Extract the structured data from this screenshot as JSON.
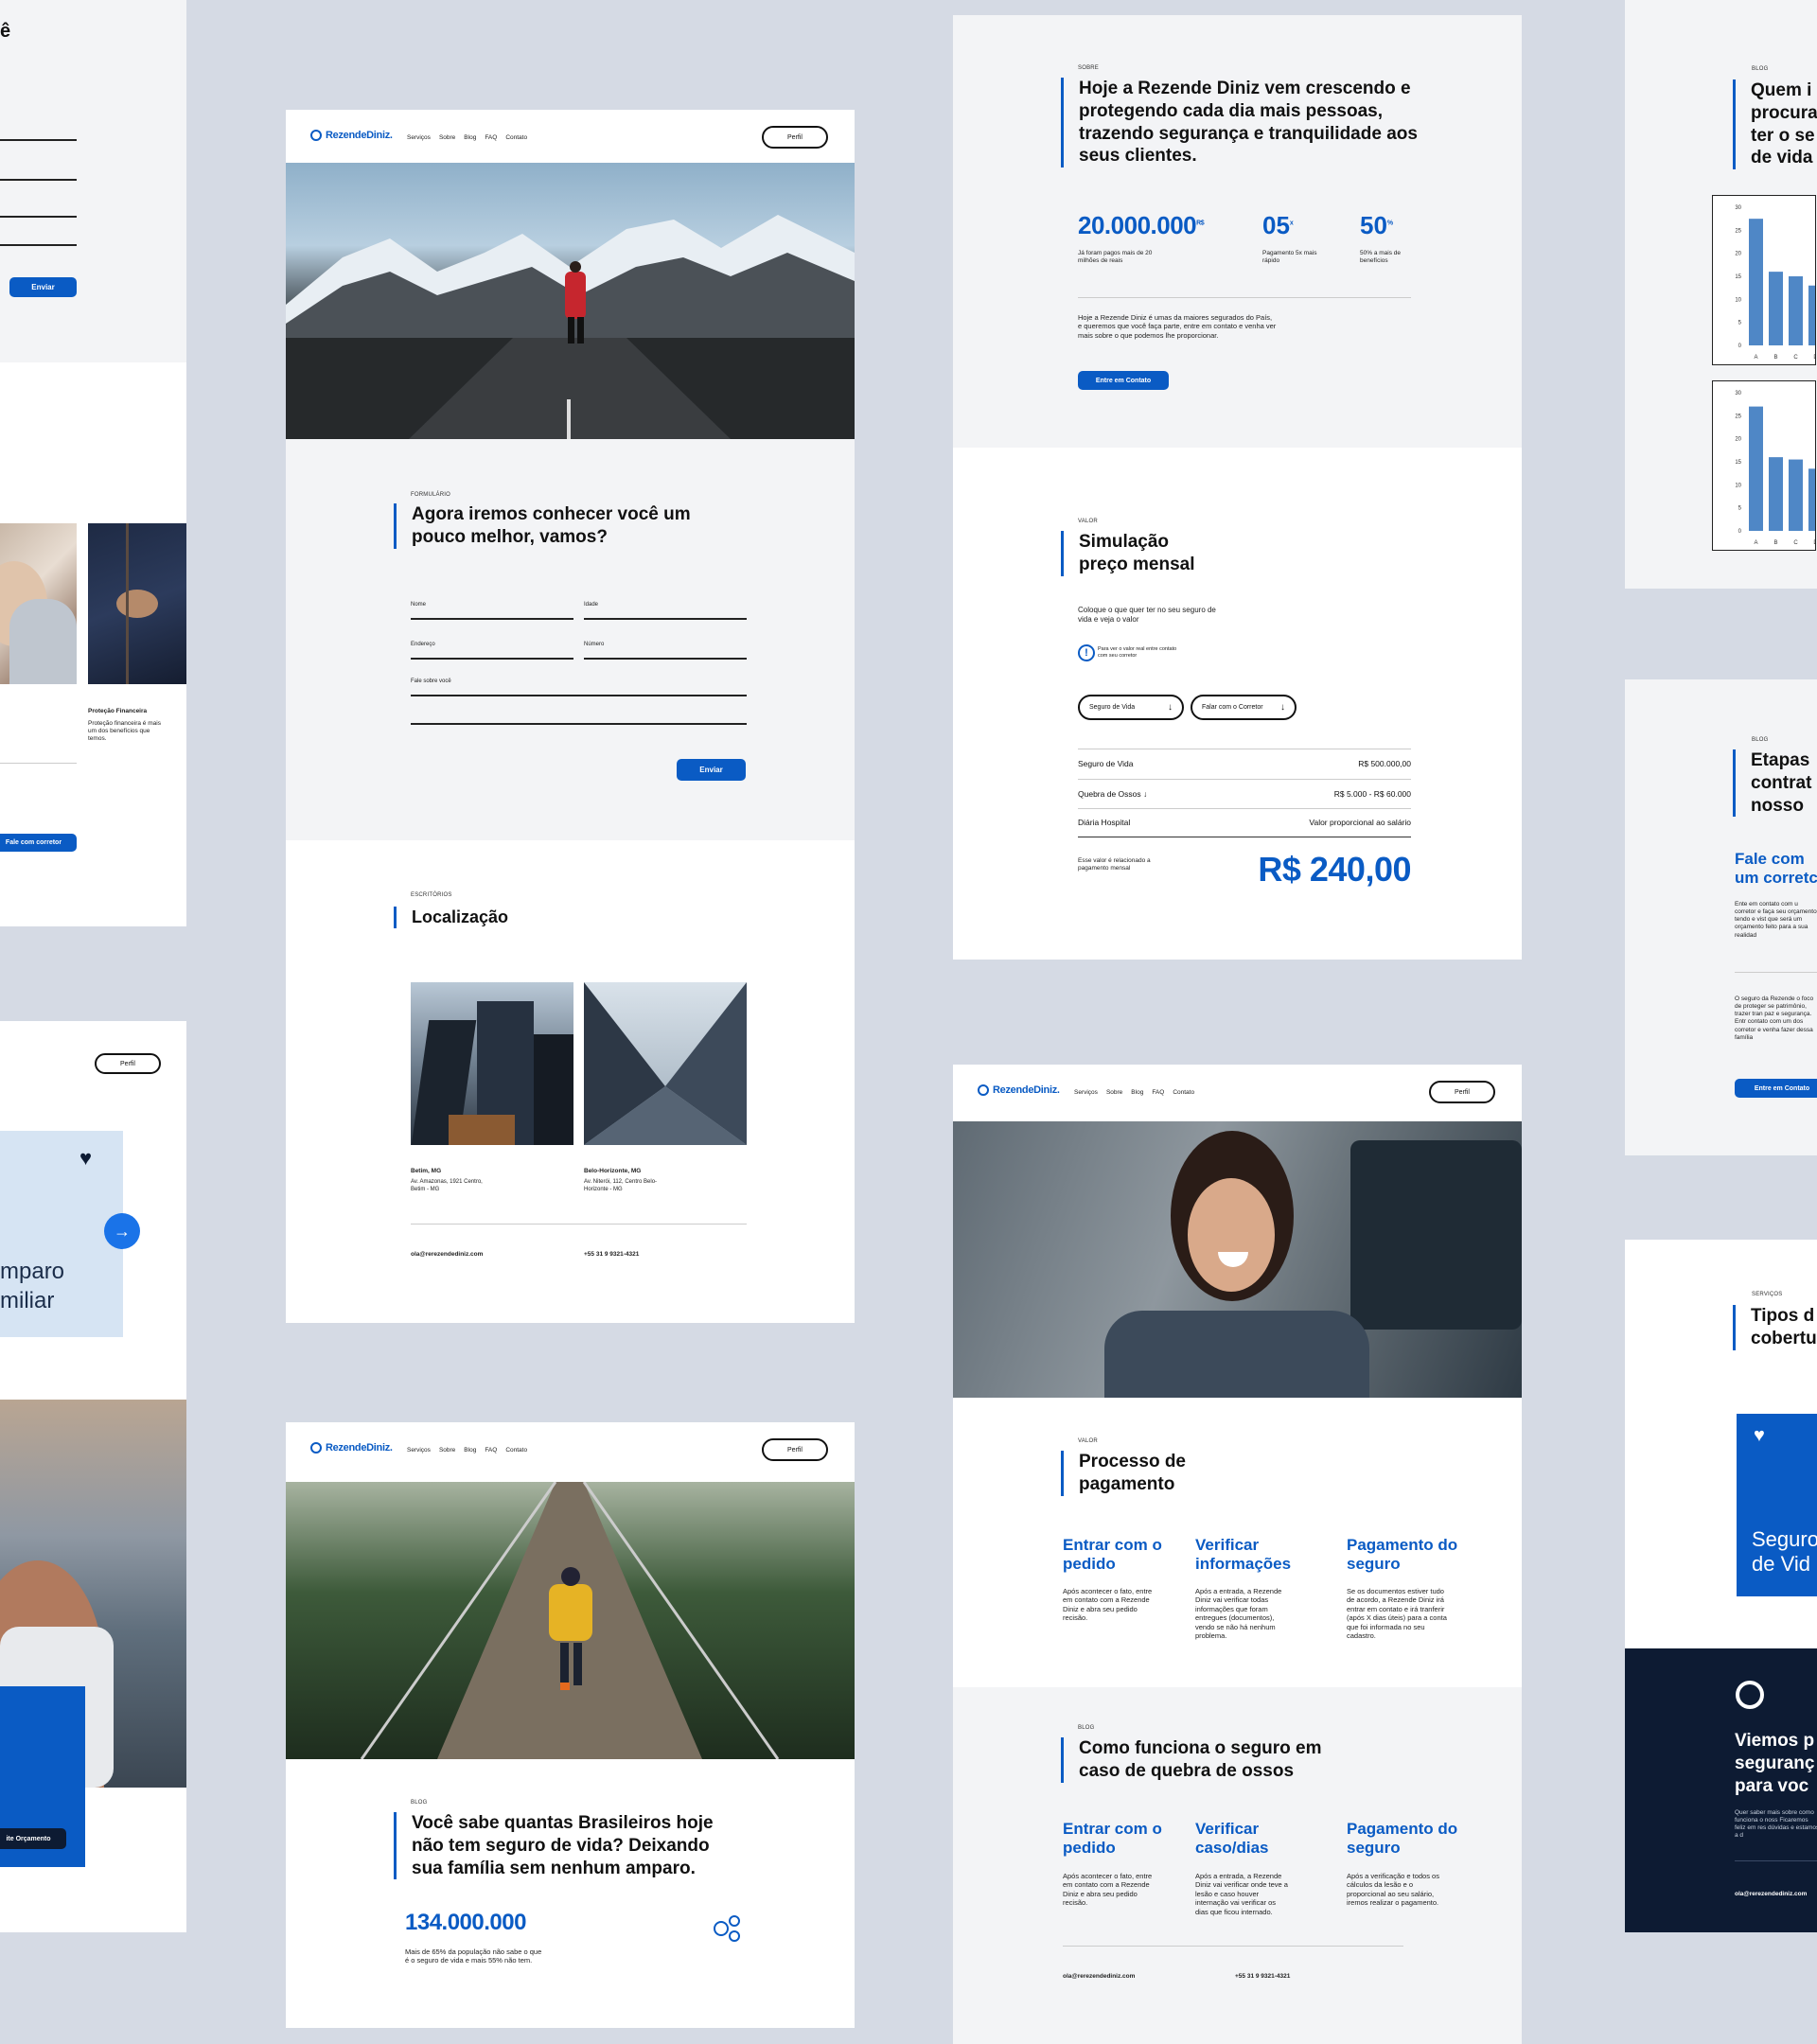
{
  "brand": {
    "logo": "RezendeDiniz.",
    "accent": "#0a5bc4",
    "dark": "#0d1b33"
  },
  "nav": {
    "items": [
      "Serviços",
      "Sobre",
      "Blog",
      "FAQ",
      "Contato"
    ],
    "profile": "Perfil"
  },
  "left_cards": {
    "top_fragment": "ê",
    "send": "Enviar",
    "protecao_title": "Proteção Financeira",
    "protecao_text": "Proteção financeira é mais um dos benefícios que temos.",
    "fale_corretor": "Fale com corretor",
    "amparo_line1": "mparo",
    "amparo_line2": "miliar",
    "orcamento": "ite Orçamento"
  },
  "form_page": {
    "tag": "FORMULÁRIO",
    "title": "Agora iremos conhecer você um pouco melhor, vamos?",
    "fields": {
      "nome": "Nome",
      "idade": "Idade",
      "endereco": "Endereço",
      "numero": "Número",
      "sobre": "Fale sobre você"
    },
    "send": "Enviar",
    "loc_tag": "ESCRITÓRIOS",
    "loc_title": "Localização",
    "office1": {
      "city": "Betim, MG",
      "addr": "Av. Amazonas, 1921 Centro, Betim - MG"
    },
    "office2": {
      "city": "Belo-Horizonte, MG",
      "addr": "Av. Niterói, 112, Centro Belo-Horizonte - MG"
    },
    "email": "ola@rerezendediniz.com",
    "phone": "+55 31 9 9321-4321"
  },
  "blog_page": {
    "tag": "BLOG",
    "title": "Você sabe quantas Brasileiros hoje não tem seguro de vida? Deixando sua família sem nenhum amparo.",
    "stat": "134.000.000",
    "stat_text": "Mais de 65% da população não sabe o que é o seguro de vida e mais 55% não tem."
  },
  "about_page": {
    "tag": "SOBRE",
    "title": "Hoje a Rezende Diniz vem crescendo e protegendo cada dia mais pessoas, trazendo segurança e tranquilidade aos seus clientes.",
    "stats": [
      {
        "value": "20.000.000",
        "sup": "R$",
        "text": "Já foram pagos mais de 20 milhões de reais"
      },
      {
        "value": "05",
        "sup": "x",
        "text": "Pagamento 5x mais rápido"
      },
      {
        "value": "50",
        "sup": "%",
        "text": "50% a mais de benefícios"
      }
    ],
    "body": "Hoje a Rezende Diniz é umas da maiores segurados do País, e queremos que você faça parte, entre em contato e venha ver mais sobre o que podemos lhe proporcionar.",
    "cta": "Entre em Contato",
    "sim_tag": "VALOR",
    "sim_title": "Simulação preço mensal",
    "sim_sub": "Coloque o que quer ter no seu seguro de vida e veja o valor",
    "sim_note": "Para ver o valor real entre contato com seu corretor",
    "select1": "Seguro de Vida",
    "select2": "Falar com o Corretor",
    "rows": [
      {
        "label": "Seguro de Vida",
        "value": "R$ 500.000,00"
      },
      {
        "label": "Quebra de Ossos",
        "value": "R$ 5.000 - R$ 60.000"
      },
      {
        "label": "Diária Hospital",
        "value": "Valor proporcional ao salário"
      }
    ],
    "total_note": "Esse valor é relacionado a pagamento mensal",
    "total": "R$ 240,00"
  },
  "payment_page": {
    "tag": "VALOR",
    "title": "Processo de pagamento",
    "steps": [
      {
        "title": "Entrar com o pedido",
        "text": "Após acontecer o fato, entre em contato com a Rezende Diniz e abra seu pedido recisão."
      },
      {
        "title": "Verificar informações",
        "text": "Após a entrada, a Rezende Diniz vai verificar todas informações que foram entregues (documentos), vendo se não há nenhum problema."
      },
      {
        "title": "Pagamento do seguro",
        "text": "Se os documentos estiver tudo de acordo, a Rezende Diniz irá entrar em contato e irá tranferir (após X dias úteis) para a conta que foi informada no seu cadastro."
      }
    ],
    "bones_tag": "BLOG",
    "bones_title": "Como funciona o seguro em caso de quebra de ossos",
    "bones_steps": [
      {
        "title": "Entrar com o pedido",
        "text": "Após acontecer o fato, entre em contato com a Rezende Diniz e abra seu pedido recisão."
      },
      {
        "title": "Verificar caso/dias",
        "text": "Após a entrada, a Rezende Diniz vai verificar onde teve a lesão e caso houver internação vai verificar os dias que ficou internado."
      },
      {
        "title": "Pagamento do seguro",
        "text": "Após a verificação e todos os cálculos da lesão e o proporcional ao seu salário, iremos realizar o pagamento."
      }
    ],
    "email": "ola@rerezendediniz.com",
    "phone": "+55 31 9 9321-4321"
  },
  "right_cards": {
    "blog_tag": "BLOG",
    "blog_title_lines": [
      "Quem i",
      "procura",
      "ter o se",
      "de vida"
    ],
    "etapas_lines": [
      "Etapas",
      "contrat",
      "nosso"
    ],
    "fale_lines": [
      "Fale com",
      "um corretc"
    ],
    "fale_text": "Ente em contato com u corretor e faça seu orçamento, tendo e vist que será um orçamento feito para a sua realidad",
    "seguro_text": "O seguro da Rezende o foco de proteger se patrimônio, trazer tran paz e segurança. Entr contato com um dos corretor e venha fazer dessa família",
    "cta": "Entre em Contato",
    "tipos_tag": "SERVIÇOS",
    "tipos_lines": [
      "Tipos d",
      "cobertu"
    ],
    "seguro_card": [
      "Seguro",
      "de Vid"
    ],
    "dark_lines": [
      "Viemos p",
      "seguranç",
      "para voc"
    ],
    "dark_text": "Quer saber mais sobre como funciona o noss Ficaremos feliz em res dúvidas e estamos a d",
    "dark_email": "ola@rerezendediniz.com"
  },
  "chart_data": [
    {
      "type": "bar",
      "categories": [
        "A",
        "B",
        "C",
        "D"
      ],
      "values": [
        27.5,
        16,
        15,
        13
      ],
      "ylim": [
        0,
        30
      ],
      "yticks": [
        0,
        5,
        10,
        15,
        20,
        25,
        30
      ]
    },
    {
      "type": "bar",
      "categories": [
        "A",
        "B",
        "C",
        "D"
      ],
      "values": [
        27,
        16,
        15.5,
        13.5
      ],
      "ylim": [
        0,
        30
      ],
      "yticks": [
        0,
        5,
        10,
        15,
        20,
        25,
        30
      ]
    }
  ]
}
